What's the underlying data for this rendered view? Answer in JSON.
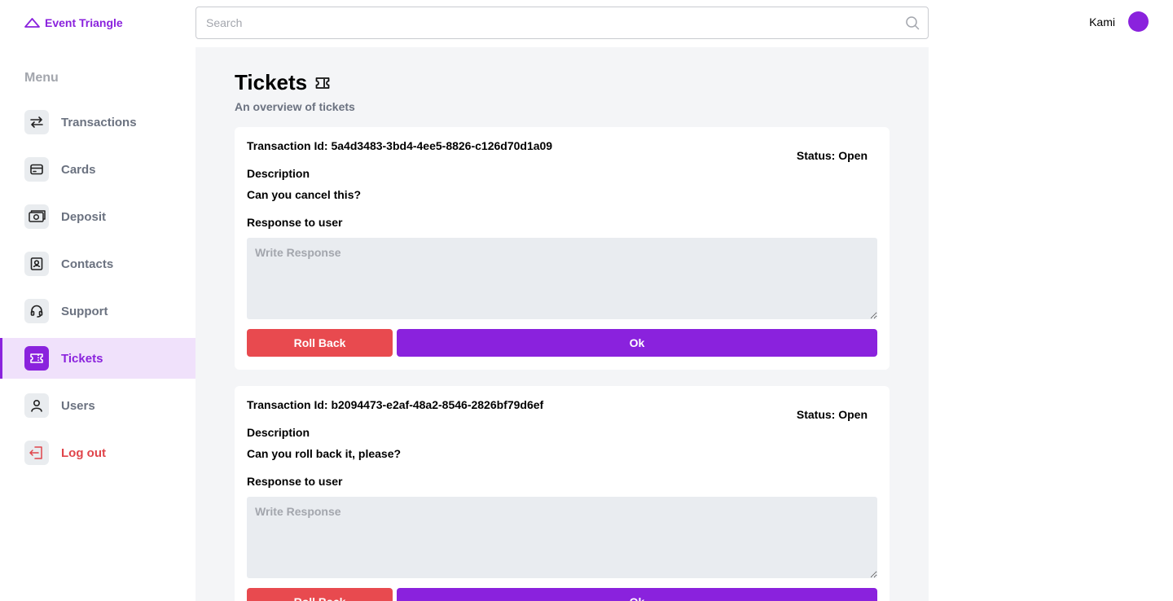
{
  "brand": {
    "name": "Event Triangle"
  },
  "search": {
    "placeholder": "Search"
  },
  "user": {
    "name": "Kami"
  },
  "sidebar": {
    "title": "Menu",
    "items": [
      {
        "label": "Transactions",
        "icon": "arrows-swap-icon"
      },
      {
        "label": "Cards",
        "icon": "credit-card-icon"
      },
      {
        "label": "Deposit",
        "icon": "cash-icon"
      },
      {
        "label": "Contacts",
        "icon": "contact-book-icon"
      },
      {
        "label": "Support",
        "icon": "headset-icon"
      },
      {
        "label": "Tickets",
        "icon": "ticket-icon",
        "active": true
      },
      {
        "label": "Users",
        "icon": "user-icon"
      },
      {
        "label": "Log out",
        "icon": "logout-icon"
      }
    ]
  },
  "page": {
    "title": "Tickets",
    "subtitle": "An overview of tickets"
  },
  "tickets": [
    {
      "transaction_id": "Transaction Id: 5a4d3483-3bd4-4ee5-8826-c126d70d1a09",
      "status": "Status: Open",
      "description_label": "Description",
      "description": "Can you cancel this?",
      "response_label": "Response to user",
      "response_placeholder": "Write Response",
      "rollback_label": "Roll Back",
      "ok_label": "Ok"
    },
    {
      "transaction_id": "Transaction Id: b2094473-e2af-48a2-8546-2826bf79d6ef",
      "status": "Status: Open",
      "description_label": "Description",
      "description": "Can you roll back it, please?",
      "response_label": "Response to user",
      "response_placeholder": "Write Response",
      "rollback_label": "Roll Back",
      "ok_label": "Ok"
    }
  ],
  "colors": {
    "accent": "#8a22dd",
    "danger": "#e84a4f",
    "active_bg": "#f0e1fb",
    "content_bg": "#f4f5f7"
  }
}
